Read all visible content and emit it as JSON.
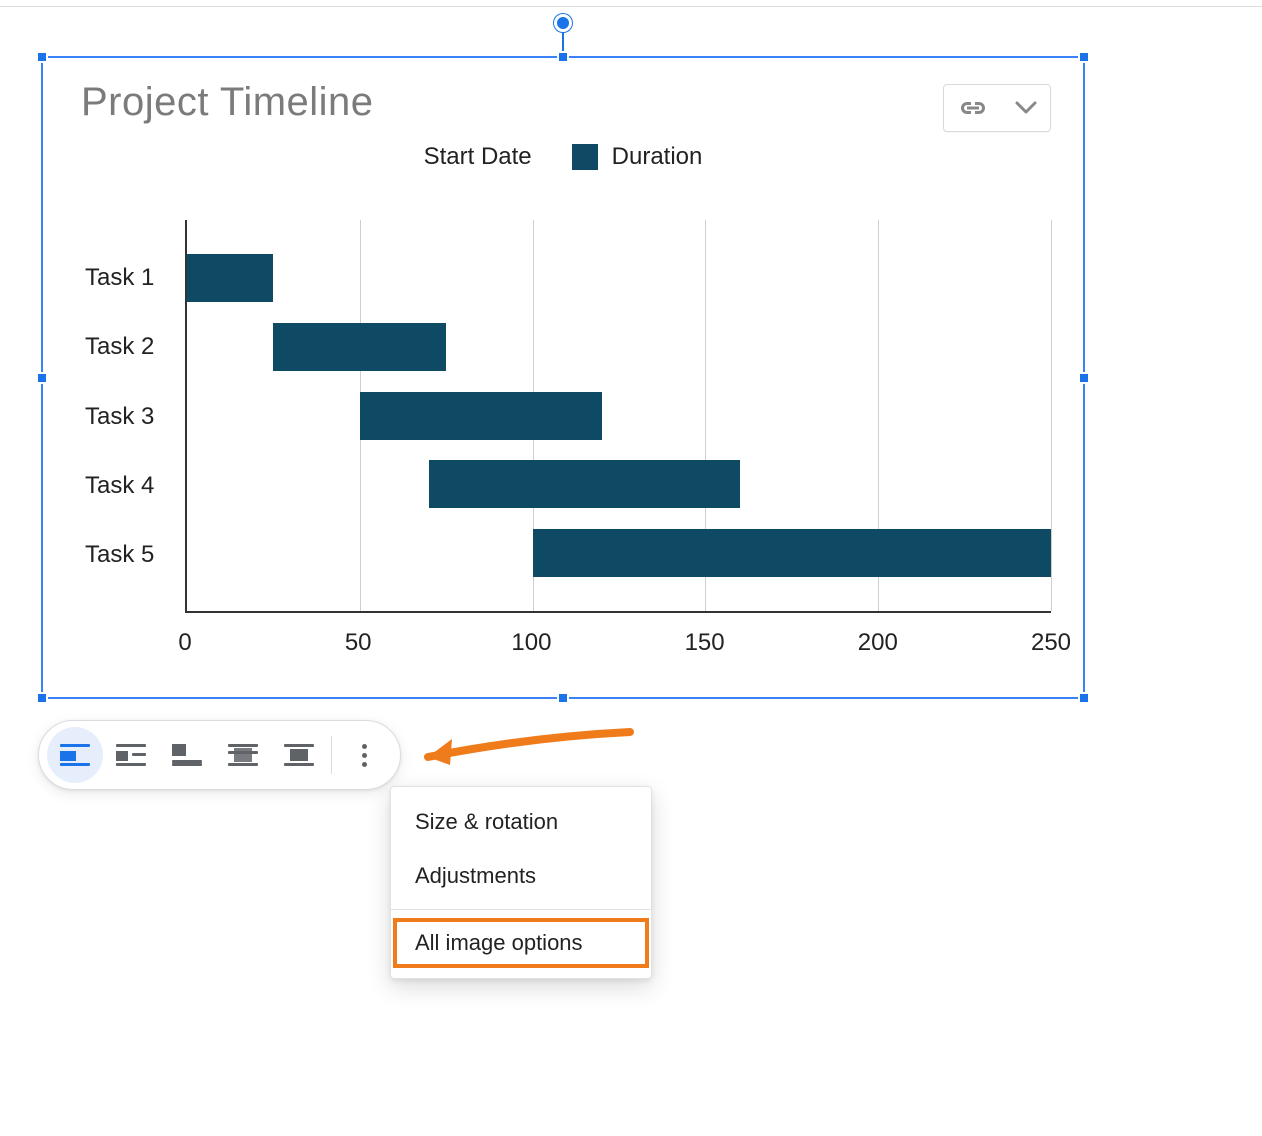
{
  "chart": {
    "title": "Project Timeline",
    "legend": {
      "start": "Start Date",
      "duration": "Duration"
    },
    "tasks": [
      {
        "label": "Task 1",
        "start": 0,
        "duration": 25
      },
      {
        "label": "Task 2",
        "start": 25,
        "duration": 50
      },
      {
        "label": "Task 3",
        "start": 50,
        "duration": 70
      },
      {
        "label": "Task 4",
        "start": 70,
        "duration": 90
      },
      {
        "label": "Task 5",
        "start": 100,
        "duration": 150
      }
    ],
    "x_ticks": [
      0,
      50,
      100,
      150,
      200,
      250
    ]
  },
  "chart_data": {
    "type": "bar",
    "orientation": "horizontal",
    "stacked": true,
    "title": "Project Timeline",
    "categories": [
      "Task 1",
      "Task 2",
      "Task 3",
      "Task 4",
      "Task 5"
    ],
    "series": [
      {
        "name": "Start Date",
        "values": [
          0,
          25,
          50,
          70,
          100
        ],
        "invisible": true
      },
      {
        "name": "Duration",
        "values": [
          25,
          50,
          70,
          90,
          150
        ],
        "color": "#0e4a63"
      }
    ],
    "xlabel": "",
    "ylabel": "",
    "xlim": [
      0,
      250
    ],
    "x_ticks": [
      0,
      50,
      100,
      150,
      200,
      250
    ],
    "grid": true,
    "legend_position": "top"
  },
  "toolbar": {
    "inline_label": "In line",
    "wrap_label": "Wrap text",
    "break_label": "Break text",
    "behind_label": "Behind text",
    "front_label": "In front of text",
    "more_label": "More"
  },
  "menu": {
    "size_rotation": "Size & rotation",
    "adjustments": "Adjustments",
    "all_image_options": "All image options"
  },
  "colors": {
    "selection": "#3b82f6",
    "bar": "#0e4a63",
    "annotation": "#ef7b1b",
    "accent": "#1a73e8"
  }
}
